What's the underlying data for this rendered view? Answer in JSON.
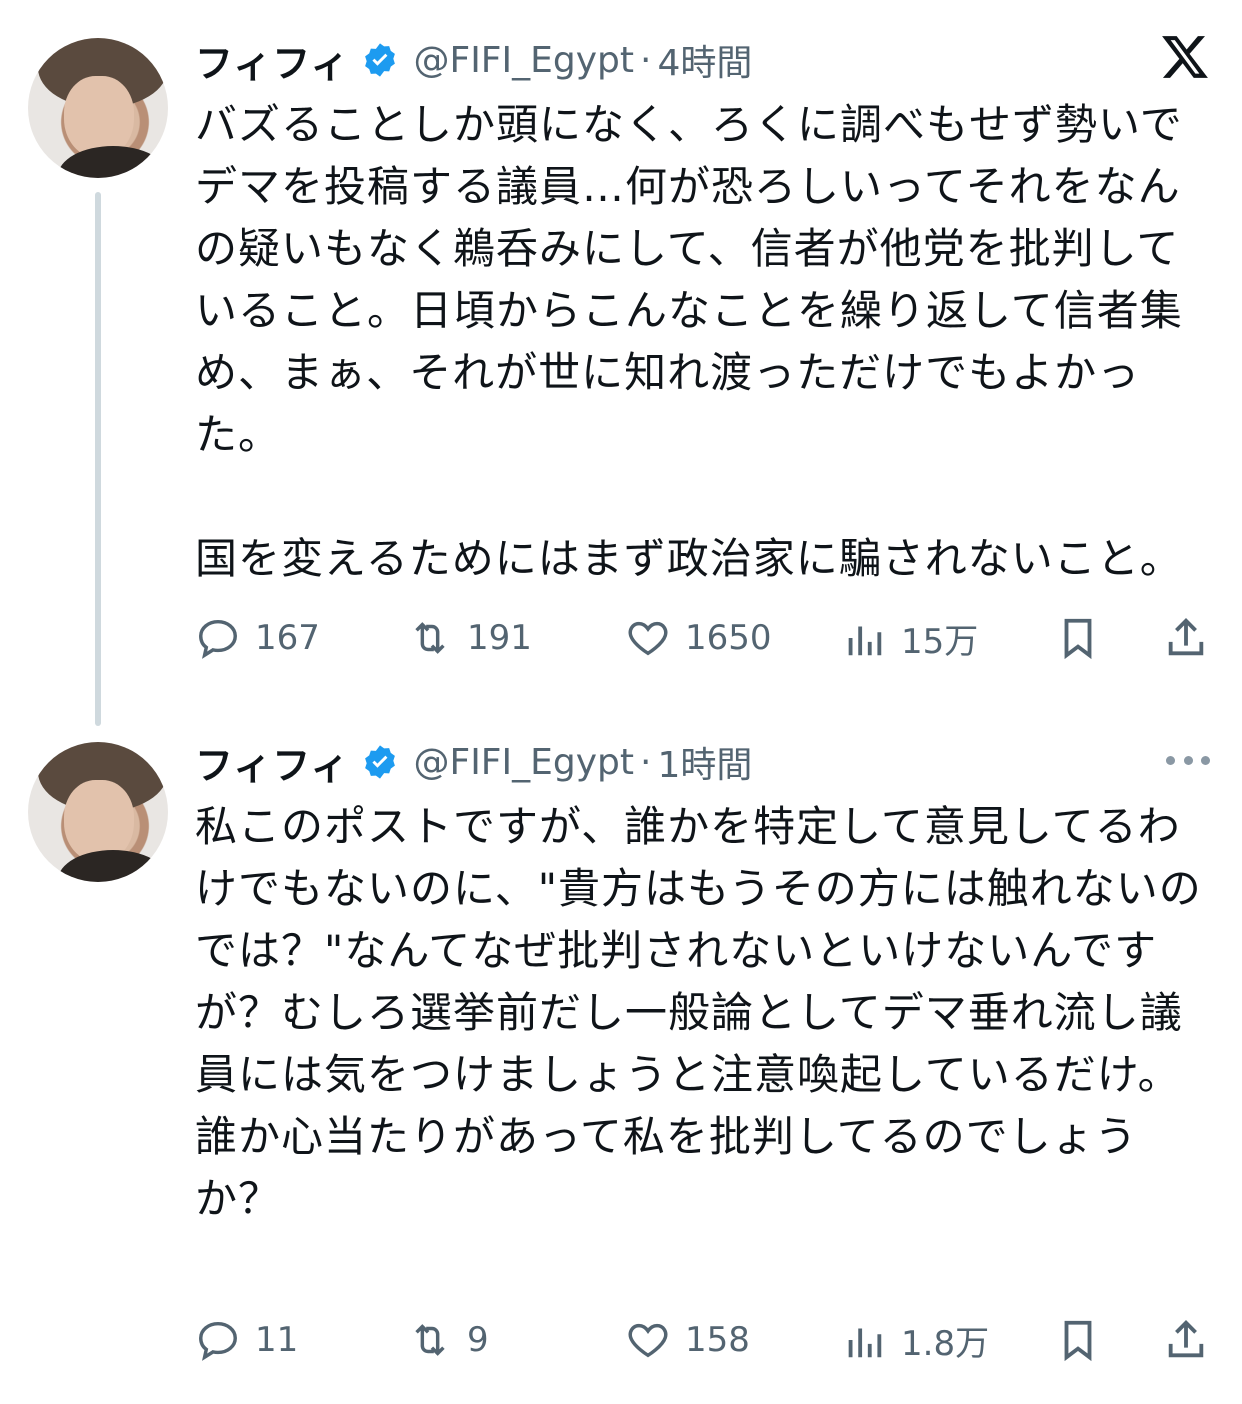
{
  "tweets": [
    {
      "author_name": "フィフィ",
      "handle": "@FIFI_Egypt",
      "separator": "·",
      "time": "4時間",
      "text": "バズることしか頭になく、ろくに調べもせず勢いでデマを投稿する議員…何が恐ろしいってそれをなんの疑いもなく鵜呑みにして、信者が他党を批判していること。日頃からこんなことを繰り返して信者集め、まぁ、それが世に知れ渡っただけでもよかった。\n\n国を変えるためにはまず政治家に騙されないこと。",
      "replies": "167",
      "reposts": "191",
      "likes": "1650",
      "views": "15万"
    },
    {
      "author_name": "フィフィ",
      "handle": "@FIFI_Egypt",
      "separator": "·",
      "time": "1時間",
      "text": "私このポストですが、誰かを特定して意見してるわけでもないのに、\"貴方はもうその方には触れないのでは？\"なんてなぜ批判されないといけないんですが？むしろ選挙前だし一般論としてデマ垂れ流し議員には気をつけましょうと注意喚起しているだけ。\n誰か心当たりがあって私を批判してるのでしょうか？",
      "replies": "11",
      "reposts": "9",
      "likes": "158",
      "views": "1.8万"
    }
  ],
  "icons": {
    "verified_color": "#1d9bf0",
    "logo": "x-logo-icon",
    "more": "more-icon"
  }
}
